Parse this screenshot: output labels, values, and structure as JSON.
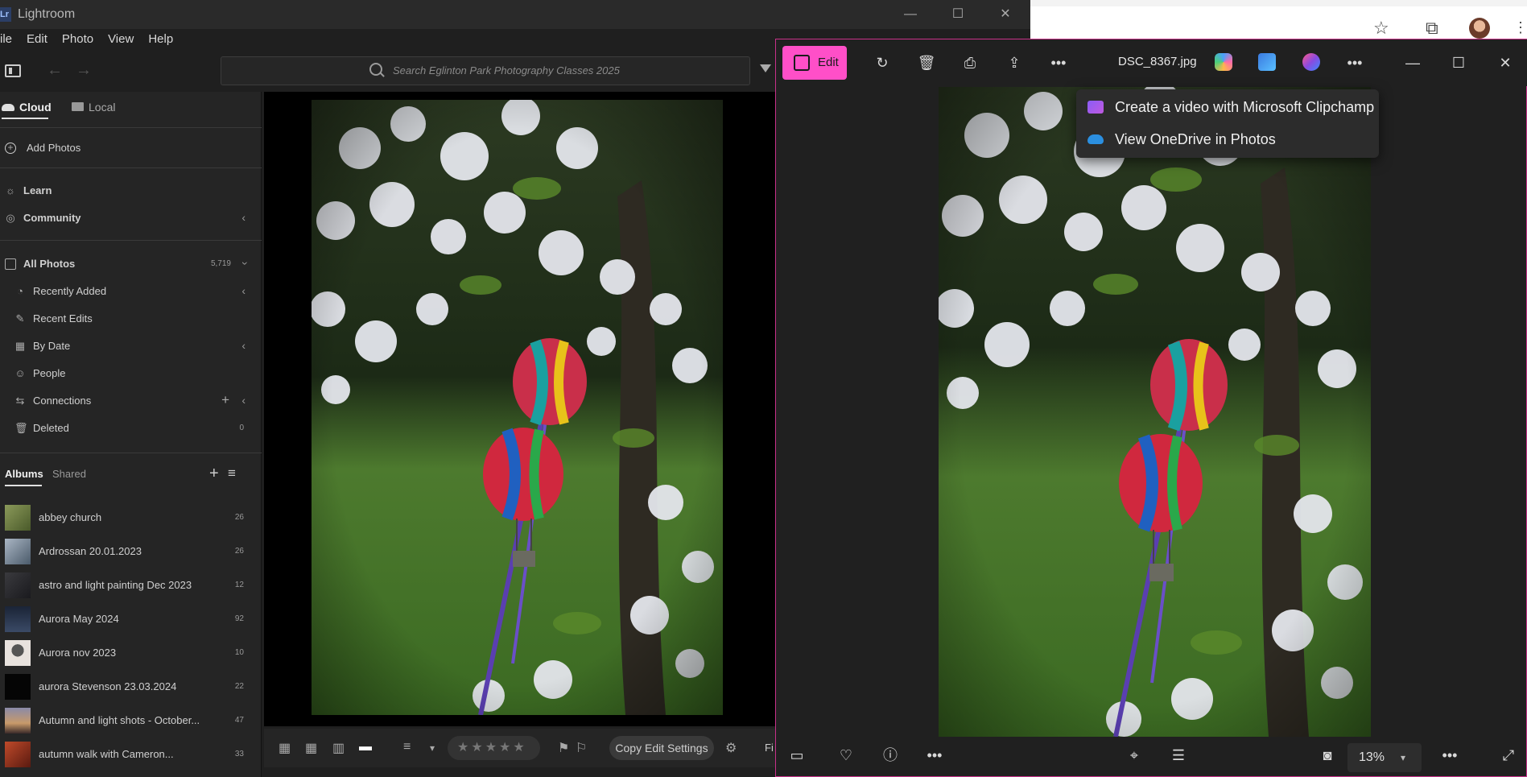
{
  "lightroom": {
    "logo": "Lr",
    "title": "Lightroom",
    "menu": [
      "ile",
      "Edit",
      "Photo",
      "View",
      "Help"
    ],
    "search_placeholder": "Search Eglinton Park Photography Classes 2025",
    "tabs": {
      "cloud": "Cloud",
      "local": "Local"
    },
    "add_photos": "Add Photos",
    "learn": "Learn",
    "community": "Community",
    "all_photos": {
      "label": "All Photos",
      "count": "5,719"
    },
    "library_items": [
      {
        "label": "Recently Added",
        "icon": "clock-icon"
      },
      {
        "label": "Recent Edits",
        "icon": "brush-icon"
      },
      {
        "label": "By Date",
        "icon": "calendar-icon"
      },
      {
        "label": "People",
        "icon": "person-icon"
      },
      {
        "label": "Connections",
        "icon": "connections-icon"
      },
      {
        "label": "Deleted",
        "icon": "trash-icon",
        "count": "0"
      }
    ],
    "album_tabs": {
      "albums": "Albums",
      "shared": "Shared"
    },
    "albums": [
      {
        "label": "abbey church",
        "count": "26",
        "thumb": "#6d7a4a"
      },
      {
        "label": "Ardrossan 20.01.2023",
        "count": "26",
        "thumb": "#8c9aa8"
      },
      {
        "label": "astro and light painting Dec 2023",
        "count": "12",
        "thumb": "#2a2a2e"
      },
      {
        "label": "Aurora May 2024",
        "count": "92",
        "thumb": "#24334a"
      },
      {
        "label": "Aurora nov 2023",
        "count": "10",
        "thumb": "#d8d0cc"
      },
      {
        "label": "aurora Stevenson 23.03.2024",
        "count": "22",
        "thumb": "#050505"
      },
      {
        "label": "Autumn and light shots - October...",
        "count": "47",
        "thumb": "#7a6a8a"
      },
      {
        "label": "autumn walk with Cameron...",
        "count": "33",
        "thumb": "#a03a2a"
      }
    ],
    "copy_edit": "Copy Edit Settings",
    "bottom_cut_label": "Fi"
  },
  "photos": {
    "edit_label": "Edit",
    "filename": "DSC_8367.jpg",
    "zoom": "13%",
    "context_menu": [
      {
        "label": "Create a video with Microsoft Clipchamp",
        "icon": "clipchamp-icon",
        "color": "#8a5cf6"
      },
      {
        "label": "View OneDrive in Photos",
        "icon": "onedrive-icon",
        "color": "#2b8fe0"
      }
    ]
  },
  "colors": {
    "accent_pink": "#ff4fc8",
    "frame_border": "#c8318a"
  }
}
